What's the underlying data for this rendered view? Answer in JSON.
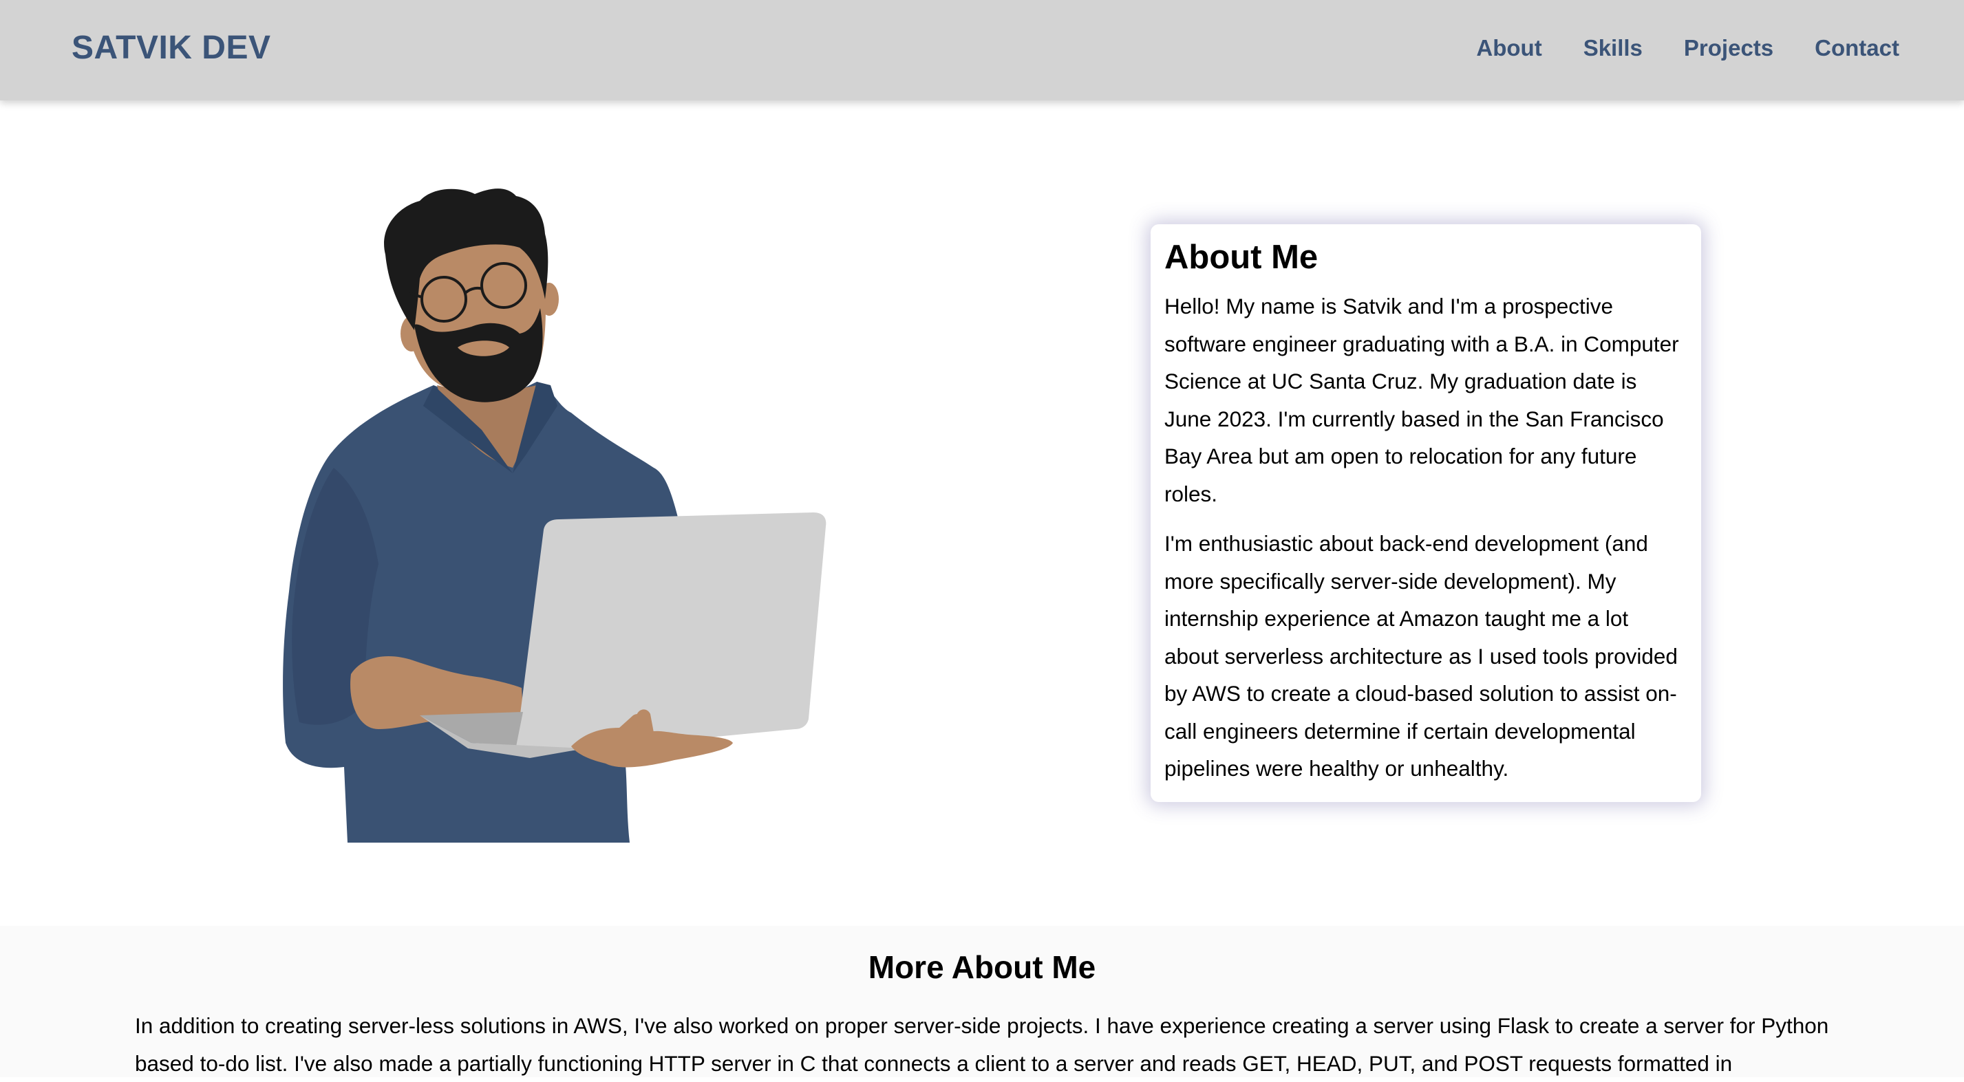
{
  "navbar": {
    "brand": "SATVIK DEV",
    "links": [
      {
        "label": "About"
      },
      {
        "label": "Skills"
      },
      {
        "label": "Projects"
      },
      {
        "label": "Contact"
      }
    ]
  },
  "hero": {
    "illustration_icon": "man-with-laptop-illustration"
  },
  "about_card": {
    "title": "About Me",
    "paragraphs": [
      "Hello! My name is Satvik and I'm a prospective software engineer graduating with a B.A. in Computer Science at UC Santa Cruz. My graduation date is June 2023. I'm currently based in the San Francisco Bay Area but am open to relocation for any future roles.",
      "I'm enthusiastic about back-end development (and more specifically server-side development). My internship experience at Amazon taught me a lot about serverless architecture as I used tools provided by AWS to create a cloud-based solution to assist on-call engineers determine if certain developmental pipelines were healthy or unhealthy."
    ]
  },
  "more_about": {
    "title": "More About Me",
    "paragraph": "In addition to creating server-less solutions in AWS, I've also worked on proper server-side projects. I have experience creating a server using Flask to create a server for Python based to-do list. I've also made a partially functioning HTTP server in C that connects a client to a server and reads GET, HEAD, PUT, and POST requests formatted in"
  },
  "colors": {
    "navbar_bg": "#d3d3d3",
    "brand_text": "#3b5478",
    "shirt": "#3a5273",
    "skin": "#b98a66",
    "laptop": "#d1d1d1"
  }
}
